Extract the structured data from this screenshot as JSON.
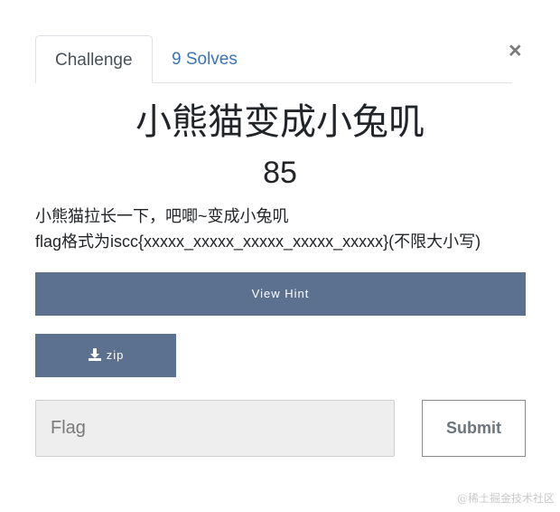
{
  "tabs": [
    {
      "label": "Challenge",
      "active": true
    },
    {
      "label": "9 Solves",
      "active": false
    }
  ],
  "close_label": "×",
  "challenge": {
    "title": "小熊猫变成小兔叽",
    "points": "85",
    "description": [
      "小熊猫拉长一下，吧唧~变成小兔叽",
      "flag格式为iscc{xxxxx_xxxxx_xxxxx_xxxxx_xxxxx}(不限大小写)"
    ]
  },
  "hint_button": {
    "label": "View Hint"
  },
  "file_button": {
    "label": "zip",
    "icon": "download-icon"
  },
  "flag_input": {
    "placeholder": "Flag",
    "value": ""
  },
  "submit_button": {
    "label": "Submit"
  },
  "watermark": "@稀土掘金技术社区",
  "colors": {
    "button_bg": "#5b718f",
    "tab_link": "#3a74b4"
  }
}
